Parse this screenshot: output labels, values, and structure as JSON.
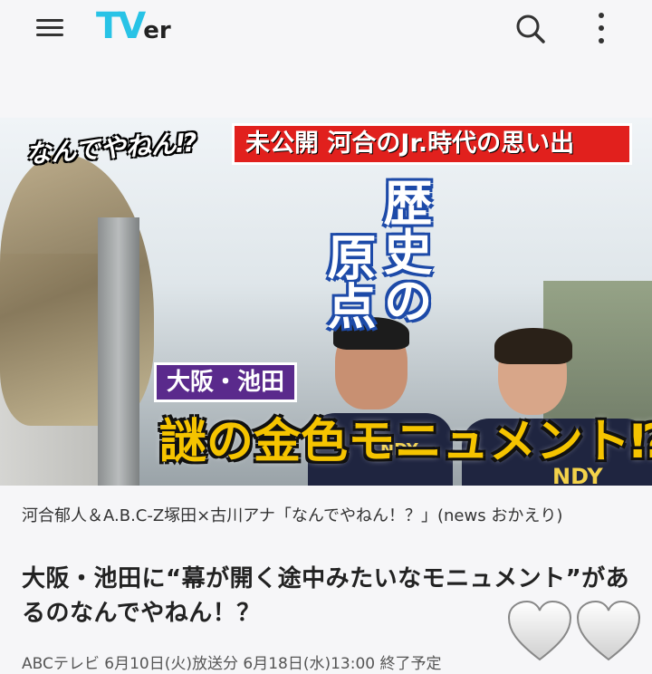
{
  "header": {
    "logo_tv": "TV",
    "logo_er": "er",
    "icons": [
      "hamburger-menu-icon",
      "search-icon",
      "more-vertical-icon"
    ],
    "accent": "#28c3e6"
  },
  "thumbnail": {
    "tag_left": "なんでやねん⁉",
    "tag_red": "未公開 河合のJr.時代の思い出",
    "vertical_col1": "歴史の",
    "vertical_col2": "原点",
    "location_tag": "大阪・池田",
    "headline": "謎の金色モニュメント⁉",
    "shirt_text_1": "NDY",
    "shirt_text_2": "NDY"
  },
  "episode": {
    "program": "河合郁人＆A.B.C-Z塚田×古川アナ「なんでやねん！？」(news おかえり)",
    "title": "大阪・池田に“幕が開く途中みたいなモニュメント”があるのなんでやねん！？",
    "info": "ABCテレビ  6月10日(火)放送分  6月18日(水)13:00 終了予定"
  }
}
